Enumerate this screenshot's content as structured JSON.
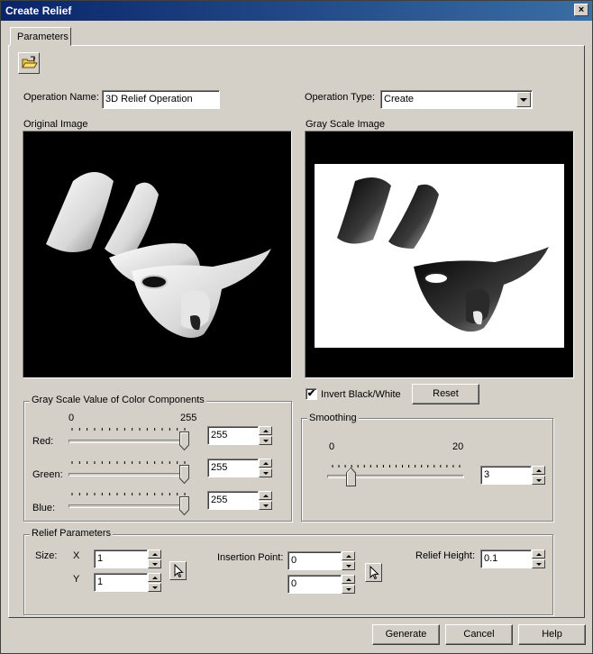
{
  "window": {
    "title": "Create Relief",
    "close_glyph": "×"
  },
  "tabs": [
    {
      "label": "Parameters"
    }
  ],
  "toolbar": {
    "open_icon": "open-folder-icon"
  },
  "operation": {
    "name_label": "Operation Name:",
    "name_value": "3D Relief Operation",
    "type_label": "Operation Type:",
    "type_value": "Create"
  },
  "images": {
    "original_label": "Original Image",
    "grayscale_label": "Gray Scale Image"
  },
  "invert": {
    "label": "Invert Black/White",
    "checked": true,
    "check_glyph": "✔"
  },
  "reset_label": "Reset",
  "gray_scale": {
    "title": "Gray Scale Value of Color Components",
    "min_label": "0",
    "max_label": "255",
    "components": [
      {
        "label": "Red:",
        "value": "255",
        "level": 1.0
      },
      {
        "label": "Green:",
        "value": "255",
        "level": 1.0
      },
      {
        "label": "Blue:",
        "value": "255",
        "level": 1.0
      }
    ]
  },
  "smoothing": {
    "title": "Smoothing",
    "min_label": "0",
    "max_label": "20",
    "value": "3",
    "level": 0.15
  },
  "relief": {
    "title": "Relief Parameters",
    "size_label": "Size:",
    "x_label": "X",
    "y_label": "Y",
    "size_x": "1",
    "size_y": "1",
    "insertion_label": "Insertion Point:",
    "insertion_1": "0",
    "insertion_2": "0",
    "height_label": "Relief Height:",
    "height_value": "0.1"
  },
  "buttons": {
    "generate": "Generate",
    "cancel": "Cancel",
    "help": "Help"
  },
  "colors": {
    "titlebar": "#0a246a",
    "face": "#d4d0c8",
    "image_bg": "#000000"
  }
}
